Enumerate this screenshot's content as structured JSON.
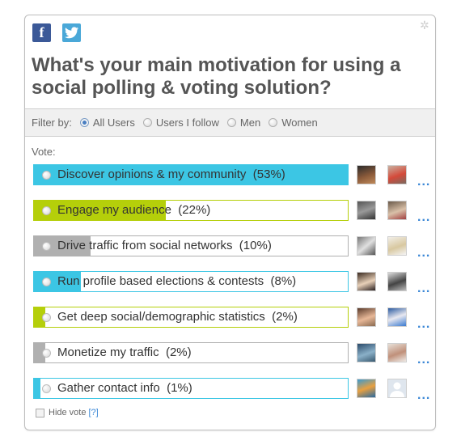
{
  "social": {
    "facebook_icon": "f",
    "twitter_icon": "t"
  },
  "question": "What's your main motivation for using a social polling & voting solution?",
  "filter": {
    "label": "Filter by:",
    "options": [
      {
        "label": "All Users",
        "selected": true
      },
      {
        "label": "Users I follow",
        "selected": false
      },
      {
        "label": "Men",
        "selected": false
      },
      {
        "label": "Women",
        "selected": false
      }
    ]
  },
  "vote_label": "Vote:",
  "options": [
    {
      "label": "Discover opinions & my community",
      "percent": "(53%)",
      "fill_fraction": 1.0,
      "color": "#3cc6e4"
    },
    {
      "label": "Engage my audience",
      "percent": "(22%)",
      "fill_fraction": 0.42,
      "color": "#b5cf0a"
    },
    {
      "label": "Drive traffic from social networks",
      "percent": "(10%)",
      "fill_fraction": 0.18,
      "color": "#b0b0b0"
    },
    {
      "label": "Run profile based elections & contests",
      "percent": "(8%)",
      "fill_fraction": 0.15,
      "color": "#3cc6e4"
    },
    {
      "label": "Get deep social/demographic statistics",
      "percent": "(2%)",
      "fill_fraction": 0.035,
      "color": "#b5cf0a"
    },
    {
      "label": "Monetize my traffic",
      "percent": "(2%)",
      "fill_fraction": 0.035,
      "color": "#b0b0b0"
    },
    {
      "label": "Gather contact info",
      "percent": "(1%)",
      "fill_fraction": 0.02,
      "color": "#3cc6e4"
    }
  ],
  "more_label": "...",
  "hide_vote": {
    "label": "Hide vote",
    "help": "[?]"
  }
}
